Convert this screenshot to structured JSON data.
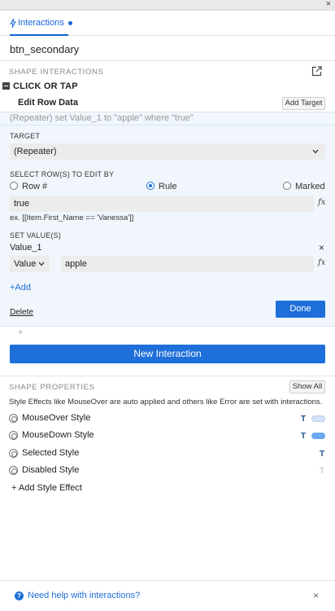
{
  "window": {
    "close_icon": "×"
  },
  "tabs": [
    {
      "label": "Interactions",
      "icon": "lightning-icon",
      "has_unsaved_dot": true
    }
  ],
  "widget": {
    "name": "btn_secondary"
  },
  "shape_interactions": {
    "section_title": "SHAPE INTERACTIONS",
    "open_external_icon": "open-in-new-icon",
    "event": {
      "label": "CLICK OR TAP"
    },
    "action": {
      "title": "Edit Row Data",
      "add_target_label": "Add Target",
      "summary": "(Repeater) set Value_1 to \"apple\" where \"true\"",
      "target": {
        "label": "TARGET",
        "value": "(Repeater)"
      },
      "select_rows": {
        "label": "SELECT ROW(S) TO EDIT BY",
        "options": [
          {
            "label": "Row #",
            "selected": false
          },
          {
            "label": "Rule",
            "selected": true
          },
          {
            "label": "Marked",
            "selected": false
          }
        ],
        "rule_value": "true",
        "fx_label": "fx",
        "example": "ex. [[Item.First_Name == 'Vanessa']]"
      },
      "set_values": {
        "label": "SET VALUE(S)",
        "column": "Value_1",
        "remove_icon": "×",
        "mode": "Value",
        "value": "apple",
        "fx_label": "fx"
      },
      "add_label": "+Add",
      "delete_label": "Delete",
      "done_label": "Done"
    },
    "add_action_icon": "+",
    "new_interaction_label": "New Interaction"
  },
  "shape_properties": {
    "section_title": "SHAPE PROPERTIES",
    "show_all_label": "Show All",
    "description": "Style Effects like MouseOver are auto applied and others like Error are set with interactions.",
    "styles": [
      {
        "label": "MouseOver Style",
        "t": "T",
        "t_active": true,
        "swatch": "#d3e4f7"
      },
      {
        "label": "MouseDown Style",
        "t": "T",
        "t_active": true,
        "swatch": "#6aa9ec"
      },
      {
        "label": "Selected Style",
        "t": "T",
        "t_active": true,
        "swatch": null
      },
      {
        "label": "Disabled Style",
        "t": "T",
        "t_active": false,
        "swatch": null
      }
    ],
    "add_style_label": "+ Add Style Effect"
  },
  "help": {
    "label": "Need help with interactions?",
    "icon": "?",
    "close_icon": "×"
  },
  "colors": {
    "accent": "#1e6fd9",
    "tab_blue": "#1565d8",
    "panel_bg": "#f0f6fc"
  }
}
